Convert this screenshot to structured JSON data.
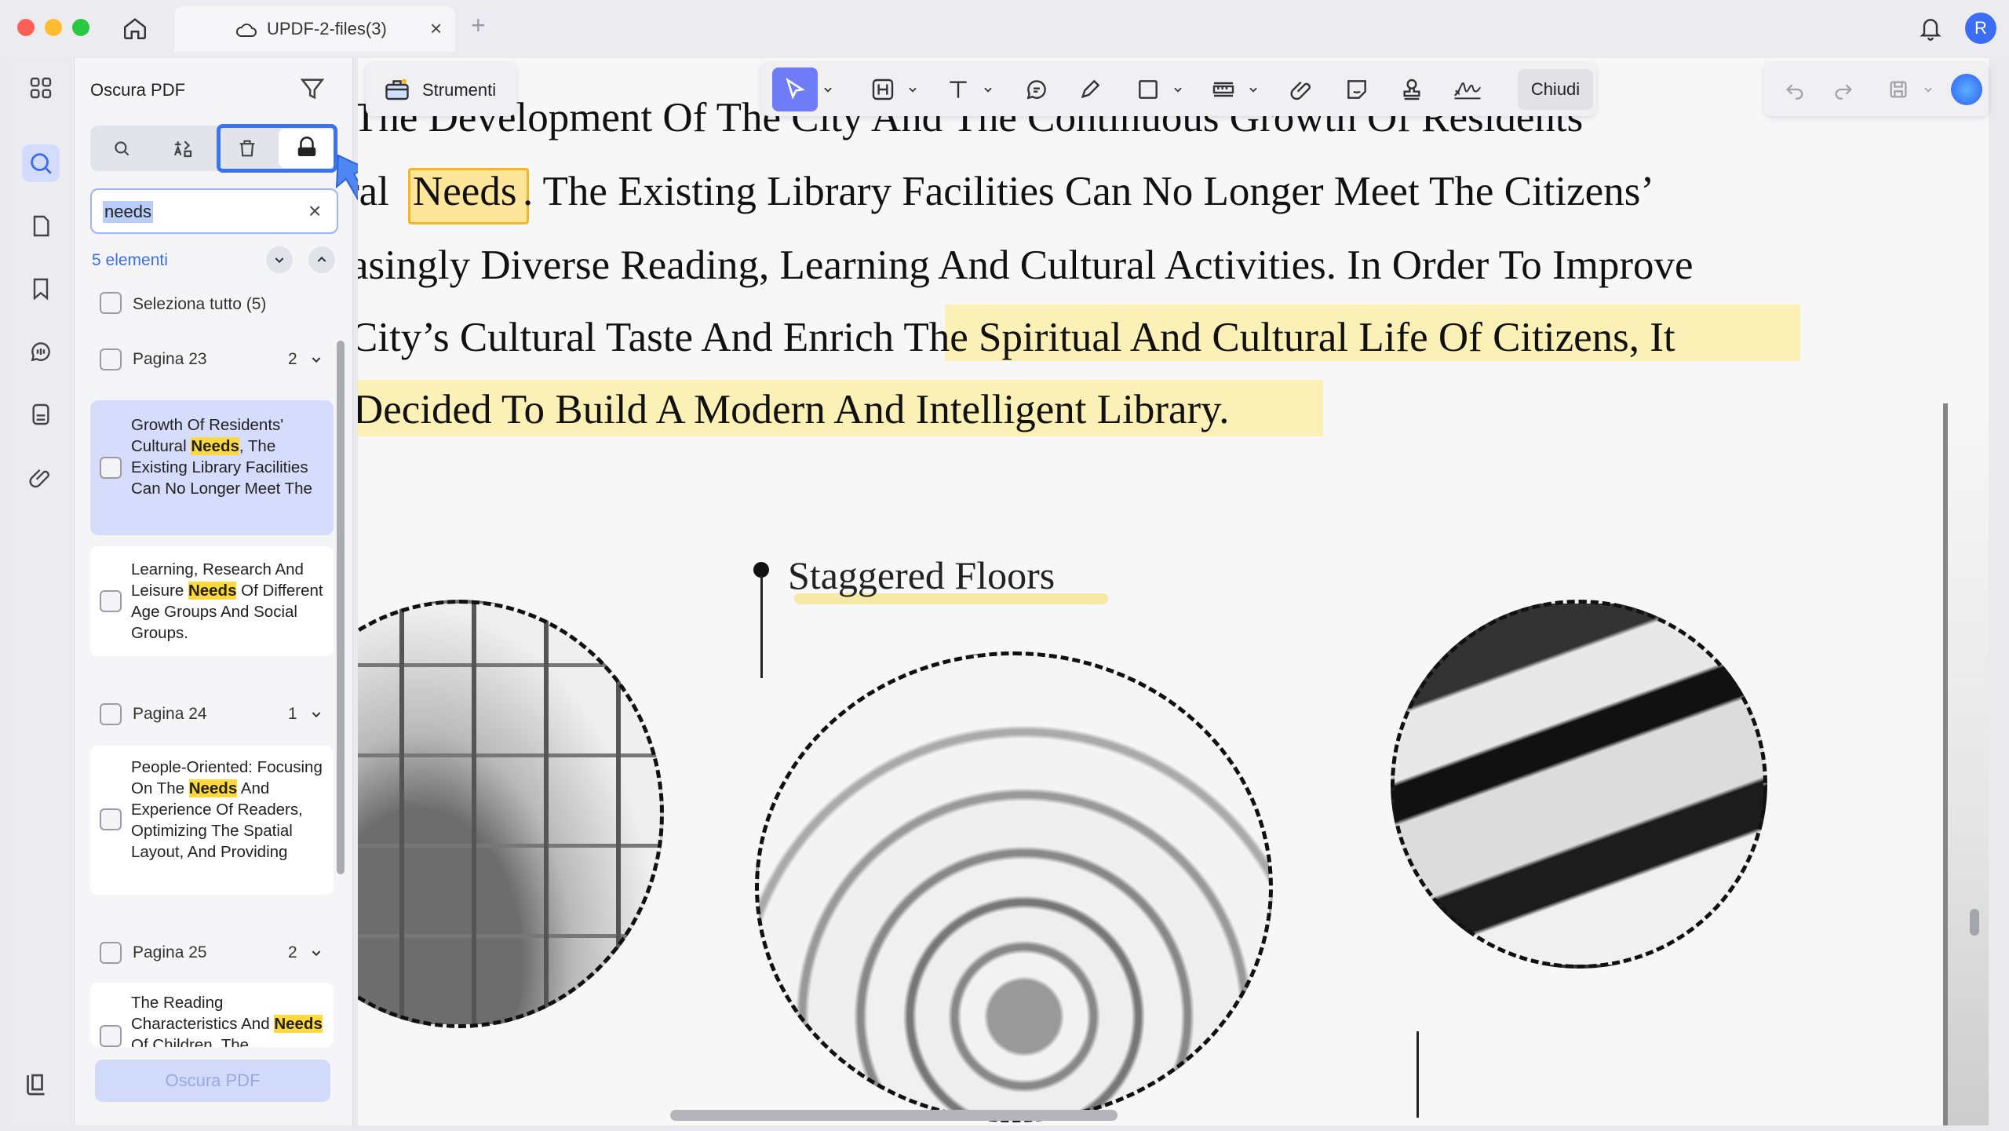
{
  "window": {
    "tab_title": "UPDF-2-files(3)",
    "tab_close": "×",
    "tab_add": "+",
    "avatar_letter": "R"
  },
  "sidebar": {
    "title": "Oscura PDF",
    "search_value": "needs",
    "search_clear": "×",
    "result_count": "5 elementi",
    "select_all": "Seleziona tutto  (5)",
    "pages": [
      {
        "label": "Pagina 23",
        "count": "2"
      },
      {
        "label": "Pagina 24",
        "count": "1"
      },
      {
        "label": "Pagina 25",
        "count": "2"
      }
    ],
    "results": [
      {
        "pre": "Growth Of Residents' Cultural ",
        "match": "Needs",
        "post": ", The Existing Library Facilities Can No Longer Meet The"
      },
      {
        "pre": "Learning, Research And Leisure ",
        "match": "Needs",
        "post": " Of Different Age Groups And Social Groups."
      },
      {
        "pre": "People-Oriented: Focusing On The ",
        "match": "Needs",
        "post": " And Experience Of Readers, Optimizing The Spatial Layout, And Providing"
      },
      {
        "pre": "The Reading Characteristics And ",
        "match": "Needs",
        "post": " Of Children, The"
      }
    ],
    "apply_button": "Oscura PDF"
  },
  "toolbar": {
    "tools_label": "Strumenti",
    "close_label": "Chiudi"
  },
  "document": {
    "lines": [
      "The Development Of The City And The Continuous Growth Of Residents’",
      "ral",
      "Needs",
      ". The Existing Library Facilities Can No Longer Meet The Citizens’",
      "asingly Diverse Reading, Learning And Cultural Activities. In Order To Improve",
      "City’s Cultural Taste And Enrich The Spiritual And Cultural Life Of Citizens, It",
      "Decided To Build A Modern And Intelligent Library."
    ],
    "section_heading": "Staggered Floors"
  },
  "colors": {
    "accent": "#3a74f0",
    "highlight": "#ffd93b",
    "selected_result": "#d6dcfb",
    "tool_selected": "#6e7cf7"
  }
}
